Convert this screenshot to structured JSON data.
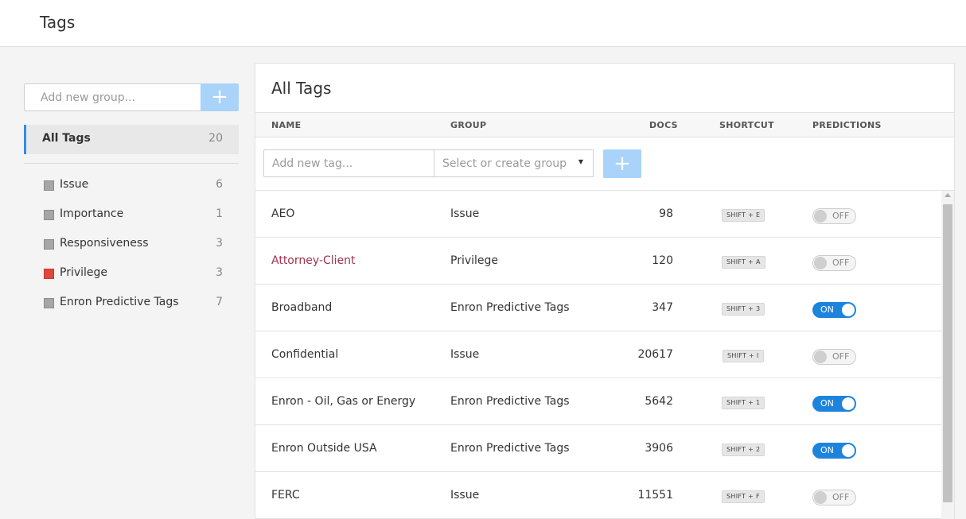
{
  "header": {
    "title": "Tags"
  },
  "sidebar": {
    "group_input_placeholder": "Add new group...",
    "add_button_label": "+",
    "all_tags": {
      "label": "All Tags",
      "count": "20"
    },
    "groups": [
      {
        "name": "Issue",
        "count": "6",
        "color": "#a6a6a6"
      },
      {
        "name": "Importance",
        "count": "1",
        "color": "#a6a6a6"
      },
      {
        "name": "Responsiveness",
        "count": "3",
        "color": "#a6a6a6"
      },
      {
        "name": "Privilege",
        "count": "3",
        "color": "#e0473a"
      },
      {
        "name": "Enron Predictive Tags",
        "count": "7",
        "color": "#a6a6a6"
      }
    ]
  },
  "main": {
    "title": "All Tags",
    "columns": {
      "name": "NAME",
      "group": "GROUP",
      "docs": "DOCS",
      "shortcut": "SHORTCUT",
      "predictions": "PREDICTIONS"
    },
    "tag_input_placeholder": "Add new tag...",
    "group_select_placeholder": "Select or create group",
    "add_tag_button_label": "+",
    "rows": [
      {
        "name": "AEO",
        "group": "Issue",
        "docs": "98",
        "shortcut": "SHIFT + E",
        "prediction": "OFF"
      },
      {
        "name": "Attorney-Client",
        "group": "Privilege",
        "docs": "120",
        "shortcut": "SHIFT + A",
        "prediction": "OFF"
      },
      {
        "name": "Broadband",
        "group": "Enron Predictive Tags",
        "docs": "347",
        "shortcut": "SHIFT + 3",
        "prediction": "ON"
      },
      {
        "name": "Confidential",
        "group": "Issue",
        "docs": "20617",
        "shortcut": "SHIFT + I",
        "prediction": "OFF"
      },
      {
        "name": "Enron - Oil, Gas or Energy",
        "group": "Enron Predictive Tags",
        "docs": "5642",
        "shortcut": "SHIFT + 1",
        "prediction": "ON"
      },
      {
        "name": "Enron Outside USA",
        "group": "Enron Predictive Tags",
        "docs": "3906",
        "shortcut": "SHIFT + 2",
        "prediction": "ON"
      },
      {
        "name": "FERC",
        "group": "Issue",
        "docs": "11551",
        "shortcut": "SHIFT + F",
        "prediction": "OFF"
      }
    ]
  },
  "colors": {
    "accent": "#1d84de",
    "button_light": "#a9d3f8",
    "privilege_text": "#a0344c"
  }
}
